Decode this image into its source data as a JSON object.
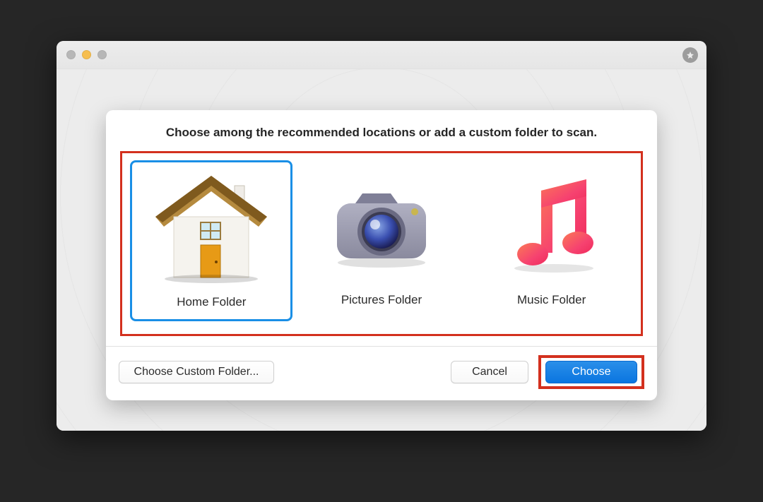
{
  "dialog": {
    "title": "Choose among the recommended locations or add a custom folder to scan."
  },
  "options": [
    {
      "id": "home",
      "label": "Home Folder",
      "selected": true
    },
    {
      "id": "pictures",
      "label": "Pictures Folder",
      "selected": false
    },
    {
      "id": "music",
      "label": "Music Folder",
      "selected": false
    }
  ],
  "buttons": {
    "custom": "Choose Custom Folder...",
    "cancel": "Cancel",
    "choose": "Choose"
  },
  "annotation": {
    "options_highlighted": true,
    "choose_highlighted": true,
    "highlight_color": "#d3301e"
  },
  "window": {
    "traffic_lights": {
      "close_enabled": false,
      "minimize_enabled": true,
      "maximize_enabled": false
    }
  }
}
